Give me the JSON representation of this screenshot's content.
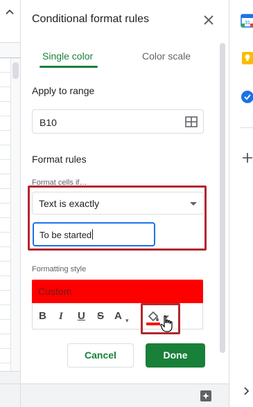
{
  "panel": {
    "title": "Conditional format rules",
    "tabs": [
      {
        "label": "Single color",
        "selected": true
      },
      {
        "label": "Color scale",
        "selected": false
      }
    ],
    "apply_range": {
      "label": "Apply to range",
      "value": "B10"
    },
    "format_rules": {
      "label": "Format rules",
      "condition_label": "Format cells if…",
      "condition_value": "Text is exactly",
      "value_input": "To be started"
    },
    "formatting_style": {
      "label": "Formatting style",
      "preview_text": "Custom",
      "preview_fill_color": "#ff0000",
      "toolbar": {
        "bold": "B",
        "italic": "I",
        "underline": "U",
        "strikethrough": "S",
        "text_color": "A"
      }
    },
    "buttons": {
      "cancel": "Cancel",
      "done": "Done"
    }
  },
  "colors": {
    "accent_green": "#188038",
    "focus_blue": "#1a73e8",
    "highlight_red": "#b3272e"
  },
  "sidebar": {
    "icons": [
      "calendar-icon",
      "keep-icon",
      "tasks-icon",
      "add-icon",
      "chevron-right-icon"
    ]
  }
}
